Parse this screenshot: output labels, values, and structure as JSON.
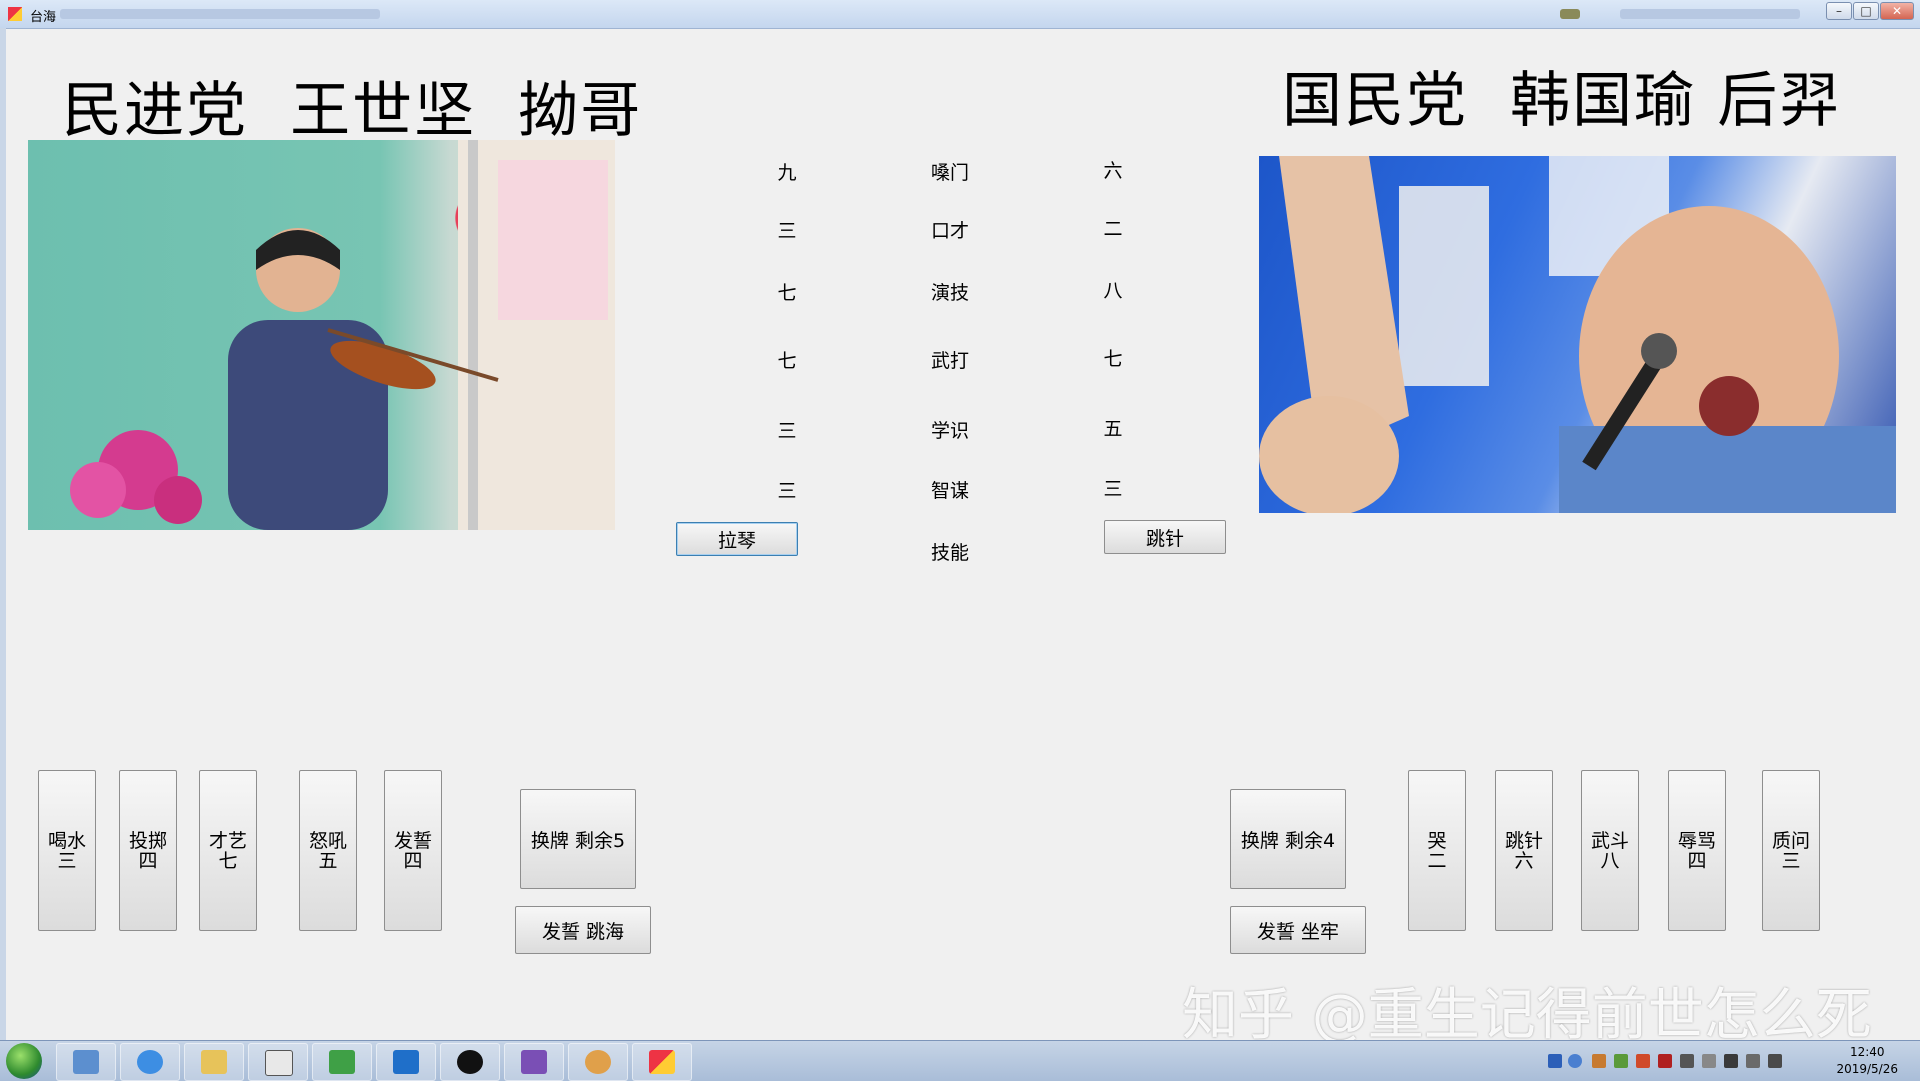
{
  "window": {
    "title": "台海"
  },
  "left_side": {
    "heading": "民进党  王世坚  拗哥",
    "skill_button": "拉琴",
    "stats": [
      "九",
      "三",
      "七",
      "七",
      "三",
      "三"
    ]
  },
  "right_side": {
    "heading": "国民党  韩国瑜 后羿",
    "skill_button": "跳针",
    "stats": [
      "六",
      "二",
      "八",
      "七",
      "五",
      "三"
    ]
  },
  "stat_labels": [
    "嗓门",
    "口才",
    "演技",
    "武打",
    "学识",
    "智谋",
    "技能"
  ],
  "left_cards": [
    {
      "name": "喝水",
      "value": "三"
    },
    {
      "name": "投掷",
      "value": "四"
    },
    {
      "name": "才艺",
      "value": "七"
    },
    {
      "name": "怒吼",
      "value": "五"
    },
    {
      "name": "发誓",
      "value": "四"
    }
  ],
  "right_cards": [
    {
      "name": "哭",
      "value": "二"
    },
    {
      "name": "跳针",
      "value": "六"
    },
    {
      "name": "武斗",
      "value": "八"
    },
    {
      "name": "辱骂",
      "value": "四"
    },
    {
      "name": "质问",
      "value": "三"
    }
  ],
  "left_actions": {
    "swap": "换牌  剩余5",
    "oath": "发誓  跳海"
  },
  "right_actions": {
    "swap": "换牌  剩余4",
    "oath": "发誓  坐牢"
  },
  "watermark": "知乎 @重生记得前世怎么死",
  "taskbar": {
    "time": "12:40",
    "date": "2019/5/26"
  }
}
